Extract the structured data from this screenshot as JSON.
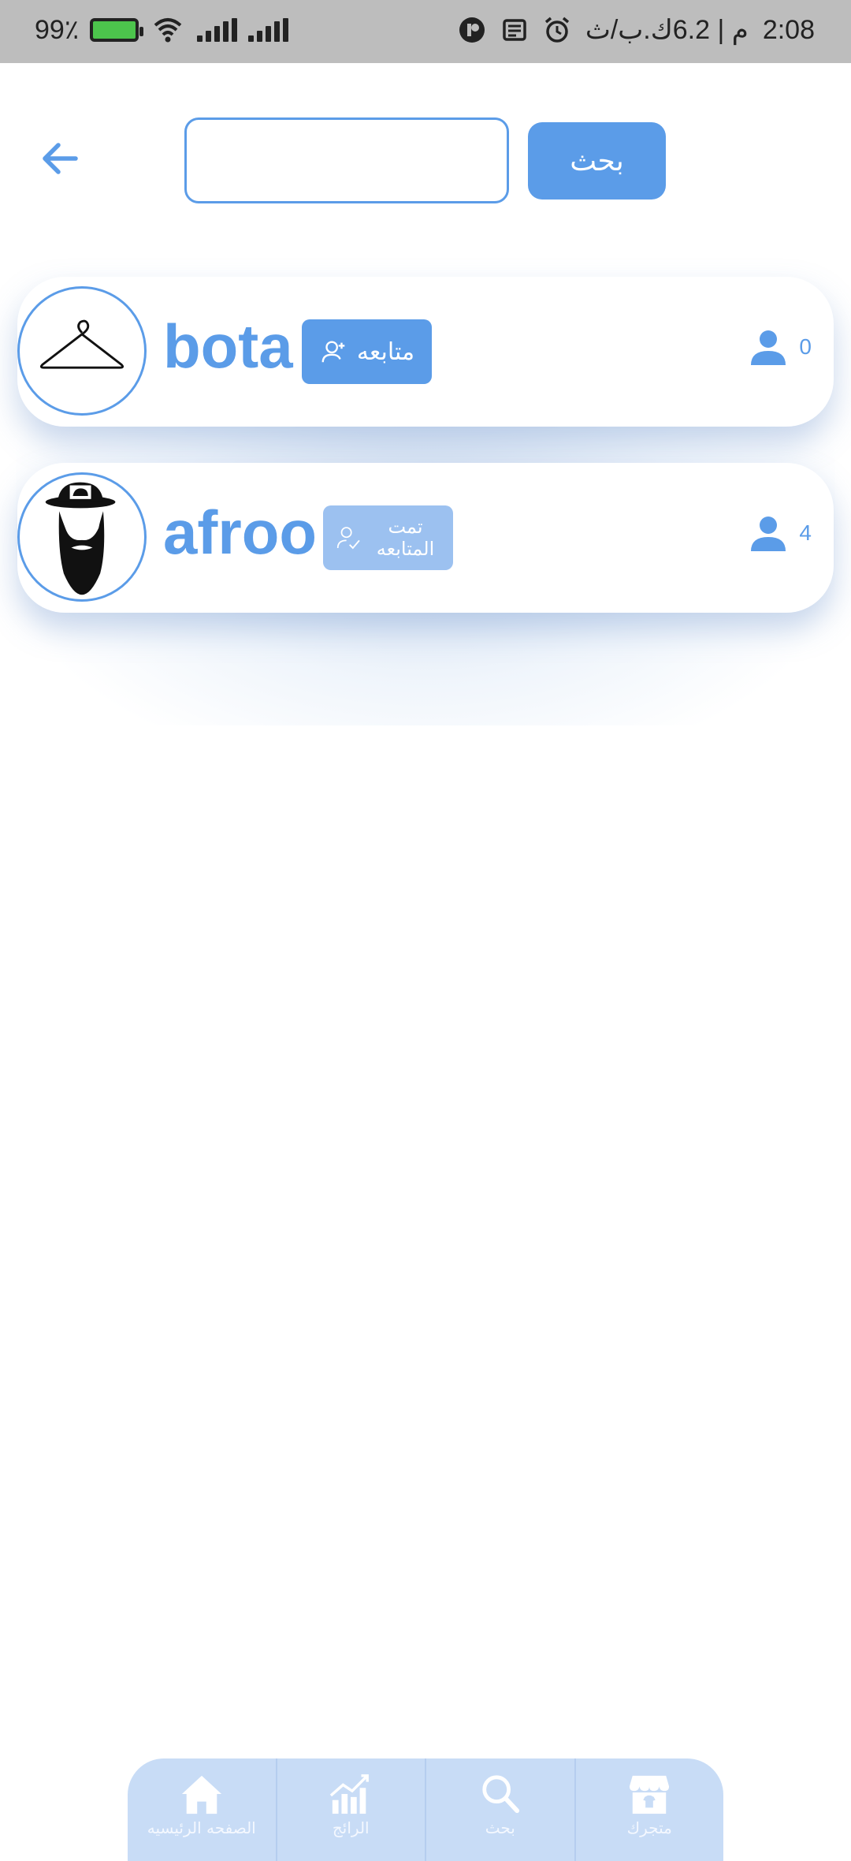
{
  "status_bar": {
    "time": "2:08",
    "speed": "م | 6.2ك.ب/ث",
    "battery": "99٪"
  },
  "search": {
    "placeholder": "",
    "button_label": "بحث"
  },
  "users": [
    {
      "username": "bota",
      "follow_label": "متابعه",
      "followers": "0",
      "avatar": "hanger-icon"
    },
    {
      "username": "afroo",
      "follow_label": "تمت المتابعه",
      "followers": "4",
      "avatar": "bearded-man-logo"
    }
  ],
  "bottom_nav": [
    {
      "label": "متجرك",
      "icon": "store-icon"
    },
    {
      "label": "بحث",
      "icon": "search-icon"
    },
    {
      "label": "الرائج",
      "icon": "trending-chart-icon"
    },
    {
      "label": "الصفحه الرئيسيه",
      "icon": "home-icon"
    }
  ],
  "colors": {
    "accent": "#5b9ce8",
    "followed": "#9cc1f0",
    "nav_bg": "#c8dcf6",
    "statusbar_bg": "#bdbdbd"
  }
}
